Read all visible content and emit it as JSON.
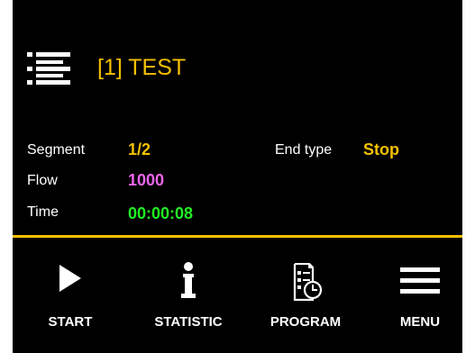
{
  "colors": {
    "background": "#000000",
    "accent": "#f5c000",
    "flow_value": "#ee66ee",
    "time_value": "#22ee22",
    "text": "#ffffff"
  },
  "header": {
    "icon": "list-icon",
    "title": "[1] TEST"
  },
  "status": {
    "segment_label": "Segment",
    "segment_value": "1/2",
    "flow_label": "Flow",
    "flow_value": "1000",
    "time_label": "Time",
    "time_value": "00:00:08",
    "end_type_label": "End type",
    "end_type_value": "Stop"
  },
  "toolbar": {
    "start_label": "START",
    "start_icon": "play-icon",
    "statistic_label": "STATISTIC",
    "statistic_icon": "info-icon",
    "program_label": "PROGRAM",
    "program_icon": "program-schedule-icon",
    "menu_label": "MENU",
    "menu_icon": "hamburger-menu-icon"
  }
}
